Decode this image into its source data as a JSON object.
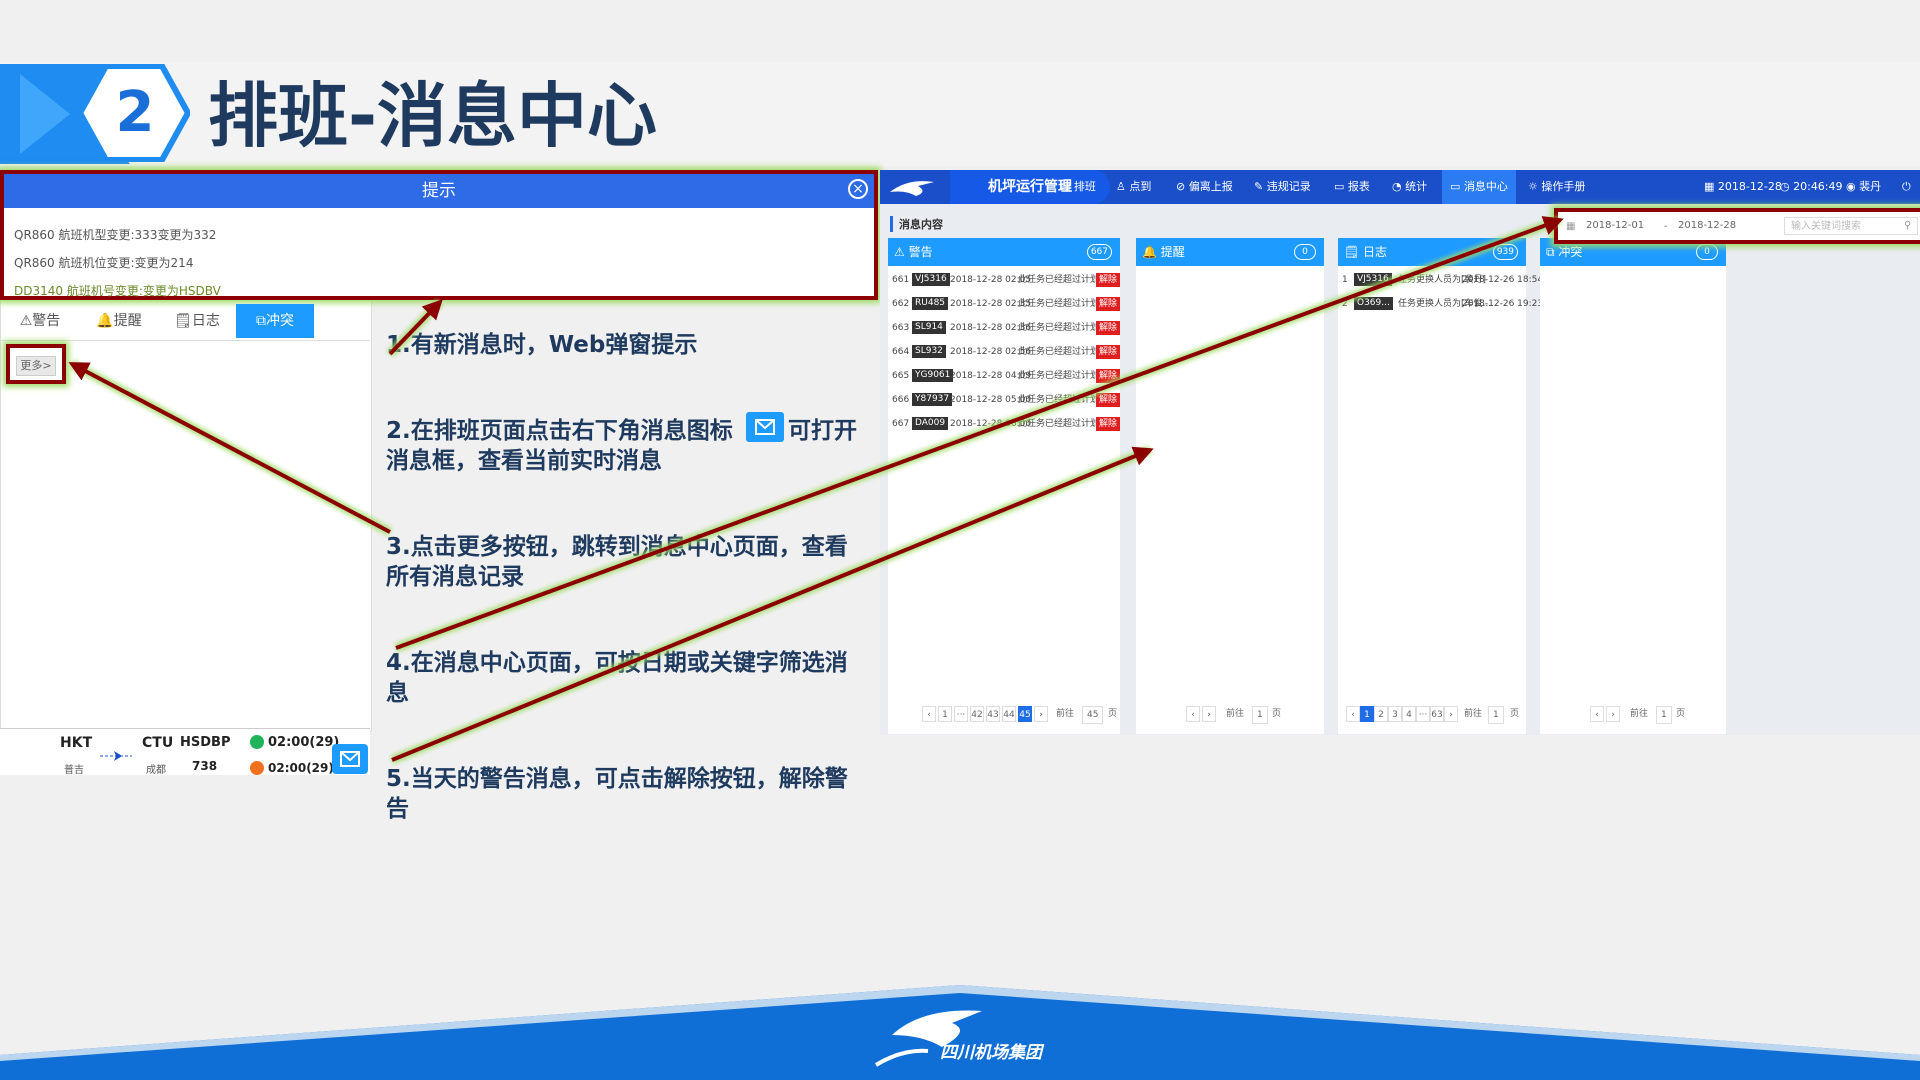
{
  "slide": {
    "number": "2",
    "title": "排班-消息中心",
    "notes": [
      "1.有新消息时，Web弹窗提示",
      "2.在排班页面点击右下角消息图标",
      "可打开",
      "消息框，查看当前实时消息",
      "3.点击更多按钮，跳转到消息中心页面，查看所有消息记录",
      "4.在消息中心页面，可按日期或关键字筛选消息",
      "5.当天的警告消息，可点击解除按钮，解除警告"
    ],
    "footer_brand": "四川机场集团"
  },
  "popup": {
    "title": "提示",
    "close_icon": "close-icon",
    "lines": [
      "QR860 航班机型变更:333变更为332",
      "QR860 航班机位变更:变更为214",
      "DD3140 航班机号变更:变更为HSDBV"
    ]
  },
  "left_app": {
    "tabs": [
      {
        "label": "⚠警告"
      },
      {
        "label": "🔔提醒"
      },
      {
        "label": "🗒日志"
      },
      {
        "label": "⧉冲突"
      }
    ],
    "more_label": "更多>",
    "flight": {
      "from": "HKT",
      "to": "CTU",
      "aircraft": "HSDBP",
      "time1": "02:00(29)",
      "from_city": "普吉",
      "to_city": "成都",
      "num": "738",
      "time2": "02:00(29)"
    }
  },
  "app": {
    "title": "机坪运行管理",
    "nav": [
      "排班",
      "点到",
      "偏离上报",
      "违规记录",
      "报表",
      "统计",
      "消息中心",
      "操作手册"
    ],
    "date": "2018-12-28",
    "time": "20:46:49",
    "user": "裴丹",
    "section_title": "消息内容",
    "filter": {
      "start": "2018-12-01",
      "sep": "-",
      "end": "2018-12-28",
      "keyword_placeholder": "输入关键词搜索"
    },
    "cards": {
      "warning": {
        "title": "⚠ 警告",
        "count": "667",
        "rows": [
          {
            "no": "661",
            "flight": "VJ5316",
            "time": "2018-12-28 02:05",
            "msg": "此任务已经超过计划...",
            "btn": "解除"
          },
          {
            "no": "662",
            "flight": "RU485",
            "time": "2018-12-28 02:35",
            "msg": "此任务已经超过计划...",
            "btn": "解除"
          },
          {
            "no": "663",
            "flight": "SL914",
            "time": "2018-12-28 02:36",
            "msg": "此任务已经超过计划...",
            "btn": "解除"
          },
          {
            "no": "664",
            "flight": "SL932",
            "time": "2018-12-28 02:56",
            "msg": "此任务已经超过计划...",
            "btn": "解除"
          },
          {
            "no": "665",
            "flight": "YG9061",
            "time": "2018-12-28 04:09",
            "msg": "此任务已经超过计划...",
            "btn": "解除"
          },
          {
            "no": "666",
            "flight": "Y87937",
            "time": "2018-12-28 05:00",
            "msg": "此任务已经超过计划...",
            "btn": "解除"
          },
          {
            "no": "667",
            "flight": "DA009",
            "time": "2018-12-28 06:00",
            "msg": "此任务已经超过计划...",
            "btn": "解除"
          }
        ],
        "pager": {
          "pages": [
            "1",
            "···",
            "42",
            "43",
            "44",
            "45"
          ],
          "goto": "前往",
          "page": "45",
          "unit": "页"
        }
      },
      "remind": {
        "title": "🔔 提醒",
        "count": "0",
        "pager": {
          "goto": "前往",
          "page": "1",
          "unit": "页"
        }
      },
      "log": {
        "title": "🗒 日志",
        "count": "939",
        "rows": [
          {
            "no": "1",
            "flight": "VJ5316",
            "msg": "任务更换人员为[裴丹]",
            "time": "2018-12-26 18:54"
          },
          {
            "no": "2",
            "flight": "O369...",
            "msg": "任务更换人员为[车俊...",
            "time": "2018-12-26 19:23"
          }
        ],
        "pager": {
          "pages": [
            "1",
            "2",
            "3",
            "4",
            "···",
            "63"
          ],
          "goto": "前往",
          "page": "1",
          "unit": "页"
        }
      },
      "conflict": {
        "title": "⧉ 冲突",
        "count": "0",
        "pager": {
          "goto": "前往",
          "page": "1",
          "unit": "页"
        }
      }
    }
  },
  "colors": {
    "brand_blue": "#1e9bff",
    "nav_blue": "#1a4fc9",
    "title_navy": "#1f3a5f",
    "highlight_border": "#8b0000",
    "highlight_glow": "#9fdc66",
    "release_red": "#e02020"
  }
}
